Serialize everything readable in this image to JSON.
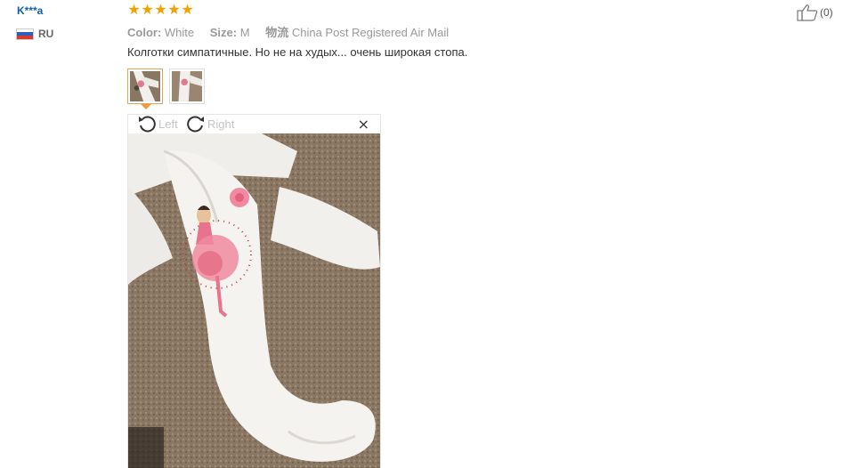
{
  "reviewer": {
    "name": "K***a",
    "country": "RU",
    "flag_colors": [
      "#ffffff",
      "#2a5fbf",
      "#d83a2f"
    ]
  },
  "review": {
    "rating": 5,
    "color_label": "Color:",
    "color_value": "White",
    "size_label": "Size:",
    "size_value": "M",
    "shipping_label": "物流",
    "shipping_value": "China Post Registered Air Mail",
    "text": "Колготки симпатичные. Но не на худых... очень широкая стопа.",
    "helpful_count": "(0)"
  },
  "thumbnails": [
    {
      "icon": "photo-thumbnail",
      "active": true
    },
    {
      "icon": "photo-thumbnail",
      "active": false
    }
  ],
  "viewer": {
    "rotate_left_label": "Left",
    "rotate_right_label": "Right",
    "close_glyph": "×",
    "star_glyph": "★"
  },
  "colors": {
    "username": "#0e5fa3",
    "star": "#f6a000",
    "meta_text": "#999999",
    "thumb_active_border": "#e6a456",
    "carpet": "#8a7763",
    "tights": "#f2f0ec"
  }
}
